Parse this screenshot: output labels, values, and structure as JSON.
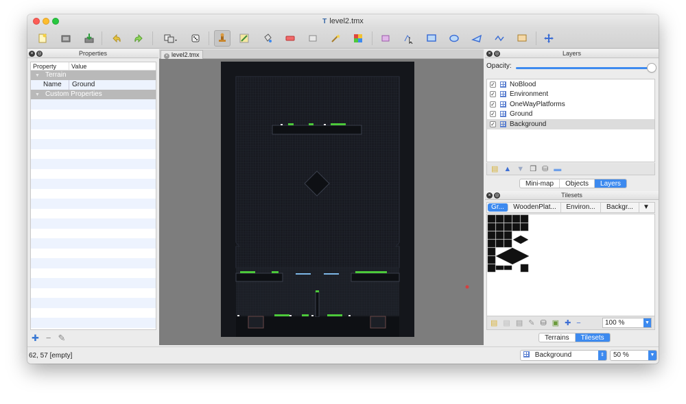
{
  "window": {
    "title": "level2.tmx"
  },
  "toolbar": {
    "icons": [
      "new-map-icon",
      "open-icon",
      "save-icon",
      "undo-icon",
      "redo-icon",
      "random-mode-icon",
      "dice-icon",
      "stamp-brush-icon",
      "terrain-brush-icon",
      "bucket-fill-icon",
      "eraser-icon",
      "rectangle-select-icon",
      "magic-wand-icon",
      "select-same-tile-icon",
      "insert-tile-icon",
      "select-objects-icon",
      "edit-polygons-icon",
      "insert-rectangle-icon",
      "insert-ellipse-icon",
      "insert-polygon-icon",
      "insert-polyline-icon",
      "insert-tile-object-icon",
      "move-icon"
    ]
  },
  "properties": {
    "panel_title": "Properties",
    "columns": [
      "Property",
      "Value"
    ],
    "group_terrain": "Terrain",
    "row_name_key": "Name",
    "row_name_value": "Ground",
    "group_custom": "Custom Properties"
  },
  "document": {
    "tab_label": "level2.tmx"
  },
  "layers": {
    "panel_title": "Layers",
    "opacity_label": "Opacity:",
    "opacity": 1.0,
    "items": [
      {
        "name": "NoBlood",
        "checked": "✓"
      },
      {
        "name": "Environment",
        "checked": "✓"
      },
      {
        "name": "OneWayPlatforms",
        "checked": "✓"
      },
      {
        "name": "Ground",
        "checked": "✓"
      },
      {
        "name": "Background",
        "checked": "✓"
      }
    ],
    "view_tabs": [
      "Mini-map",
      "Objects",
      "Layers"
    ]
  },
  "tilesets": {
    "panel_title": "Tilesets",
    "tabs": [
      "Gr...",
      "WoodenPlat...",
      "Environ...",
      "Backgr..."
    ],
    "tab_more": "▼",
    "zoom": "100 %",
    "view_tabs": [
      "Terrains",
      "Tilesets"
    ]
  },
  "status": {
    "coords": "62, 57 [empty]",
    "current_layer": "Background",
    "zoom": "50 %"
  },
  "colors": {
    "accent": "#3d8aef",
    "grass": "#4cc93a",
    "platform": "#7db8e8",
    "map_bg": "#1c1f26"
  }
}
